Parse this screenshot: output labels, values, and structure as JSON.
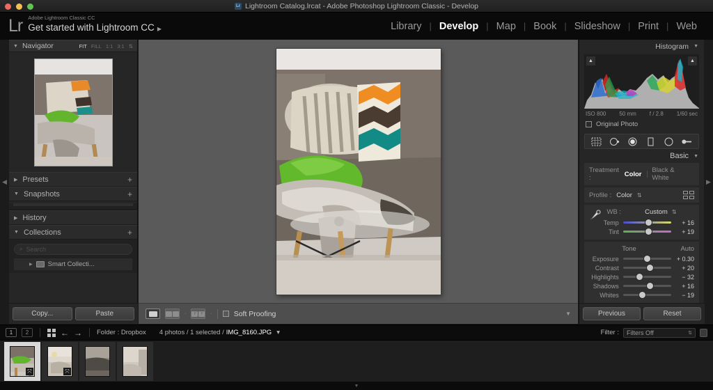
{
  "window": {
    "title": "Lightroom Catalog.lrcat - Adobe Photoshop Lightroom Classic - Develop",
    "app_badge": "Lr"
  },
  "identity": {
    "logo": "Lr",
    "line1": "Adobe Lightroom Classic CC",
    "line2": "Get started with Lightroom CC",
    "arrow": "▶"
  },
  "modules": {
    "separator": "|",
    "items": [
      {
        "label": "Library",
        "active": false
      },
      {
        "label": "Develop",
        "active": true
      },
      {
        "label": "Map",
        "active": false
      },
      {
        "label": "Book",
        "active": false
      },
      {
        "label": "Slideshow",
        "active": false
      },
      {
        "label": "Print",
        "active": false
      },
      {
        "label": "Web",
        "active": false
      }
    ]
  },
  "left_panel": {
    "navigator": {
      "title": "Navigator",
      "triangle": "▼",
      "zoom_levels": [
        "FIT",
        "FILL",
        "1:1",
        "3:1"
      ],
      "active_zoom": "FIT",
      "stepper": "⇅"
    },
    "sections": [
      {
        "label": "Presets",
        "triangle": "▶",
        "plus": "+"
      },
      {
        "label": "Snapshots",
        "triangle": "▼",
        "plus": "+"
      },
      {
        "label": "History",
        "triangle": "▶",
        "plus": ""
      },
      {
        "label": "Collections",
        "triangle": "▼",
        "plus": "+"
      }
    ],
    "collections": {
      "search_placeholder": "Search",
      "search_icon": "⌕",
      "item_label": "Smart Collecti...",
      "item_triangle": "▶"
    },
    "buttons": {
      "copy": "Copy...",
      "paste": "Paste"
    }
  },
  "center": {
    "toolbar": {
      "view_loupe": "loupe-view",
      "view_before_after_lr": "YY",
      "soft_proofing_label": "Soft Proofing",
      "soft_proofing_checked": false,
      "caret": "▼",
      "dash": "·"
    }
  },
  "right_panel": {
    "histogram": {
      "title": "Histogram",
      "triangle": "▼",
      "exif": {
        "iso": "ISO 800",
        "focal": "50 mm",
        "aperture": "f / 2.8",
        "shutter": "1/60 sec"
      },
      "original_photo_label": "Original Photo",
      "original_photo_checked": false,
      "clip_marker": "▲"
    },
    "tools": [
      "crop-overlay-icon",
      "spot-removal-icon",
      "red-eye-icon",
      "graduated-filter-icon",
      "radial-filter-icon",
      "adjustment-brush-icon"
    ],
    "basic": {
      "title": "Basic",
      "triangle": "▼",
      "treatment_label": "Treatment :",
      "treatment_options": [
        "Color",
        "Black & White"
      ],
      "treatment_selected": "Color",
      "profile_label": "Profile :",
      "profile_value": "Color",
      "profile_stepper": "⇅",
      "wb_label": "WB :",
      "wb_value": "Custom",
      "wb_stepper": "⇅",
      "eyedropper": "white-balance-selector-icon",
      "wb_sliders": [
        {
          "name": "Temp",
          "value": "+ 16",
          "pos": 52
        },
        {
          "name": "Tint",
          "value": "+ 19",
          "pos": 52
        }
      ],
      "tone_title": "Tone",
      "auto_label": "Auto",
      "tone_sliders": [
        {
          "name": "Exposure",
          "value": "+ 0.30",
          "pos": 50
        },
        {
          "name": "Contrast",
          "value": "+ 20",
          "pos": 56
        },
        {
          "name": "Highlights",
          "value": "− 32",
          "pos": 34
        },
        {
          "name": "Shadows",
          "value": "+ 16",
          "pos": 56
        },
        {
          "name": "Whites",
          "value": "− 19",
          "pos": 40
        }
      ]
    },
    "buttons": {
      "previous": "Previous",
      "reset": "Reset"
    }
  },
  "filmstrip_bar": {
    "screen1": "1",
    "screen2": "2",
    "grid_icon": "grid-view-icon",
    "back_arrow": "←",
    "forward_arrow": "→",
    "source": "Folder : Dropbox",
    "count": "4 photos / 1 selected /",
    "filename": "IMG_8160.JPG",
    "filename_caret": "▾",
    "filter_label": "Filter :",
    "filter_value": "Filters Off",
    "filter_caret": "⇅"
  },
  "filmstrip": {
    "thumbs": [
      {
        "name": "thumb-1",
        "selected": true,
        "badge": "⤧"
      },
      {
        "name": "thumb-2",
        "selected": false,
        "badge": "⤧"
      },
      {
        "name": "thumb-3",
        "selected": false,
        "badge": ""
      },
      {
        "name": "thumb-4",
        "selected": false,
        "badge": ""
      }
    ]
  },
  "edges": {
    "left_arrow": "◀",
    "right_arrow": "▶",
    "bottom_arrow": "▼"
  },
  "colors": {
    "panel_bg": "#262626",
    "canvas_bg": "#5a5a5a",
    "accent_text": "#ffffff",
    "muted_text": "#8f8f8f"
  }
}
